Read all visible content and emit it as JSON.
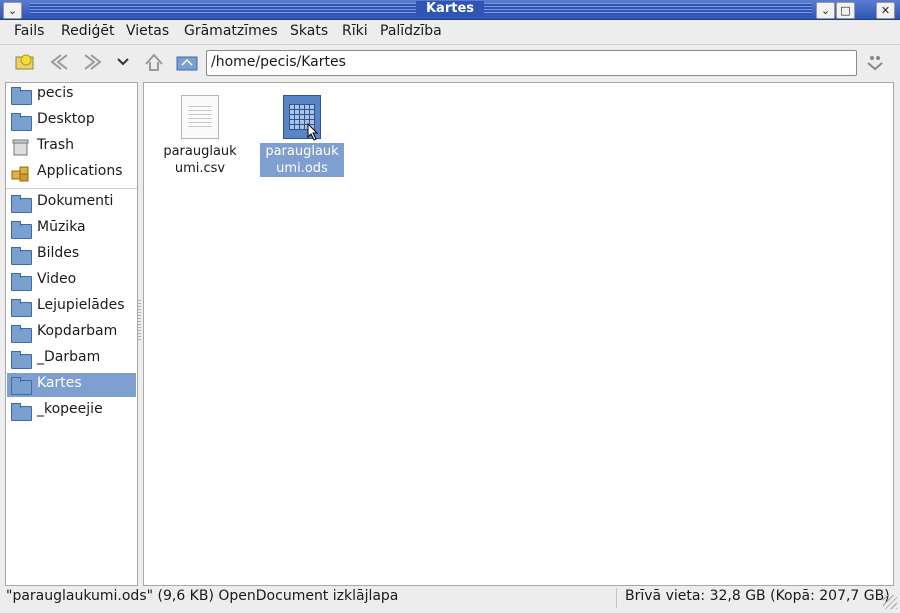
{
  "window": {
    "title": "Kartes",
    "buttons": {
      "menu": "⌄",
      "minimize": "⌄",
      "maximize": "□",
      "close": "✕"
    }
  },
  "menu": [
    "Fails",
    "Rediģēt",
    "Vietas",
    "Grāmatzīmes",
    "Skats",
    "Rīki",
    "Palīdzība"
  ],
  "toolbar": {
    "location": "/home/pecis/Kartes",
    "icons": [
      "new-folder-icon",
      "back-icon",
      "forward-icon",
      "history-dropdown-icon",
      "up-icon",
      "home-icon",
      "location-toggle-icon",
      "reload-icon"
    ]
  },
  "sidebar": {
    "places": [
      {
        "label": "pecis",
        "icon": "home-folder-icon"
      },
      {
        "label": "Desktop",
        "icon": "desktop-folder-icon"
      },
      {
        "label": "Trash",
        "icon": "trash-icon"
      },
      {
        "label": "Applications",
        "icon": "applications-icon"
      }
    ],
    "bookmarks": [
      {
        "label": "Dokumenti"
      },
      {
        "label": "Mūzika"
      },
      {
        "label": "Bildes"
      },
      {
        "label": "Video"
      },
      {
        "label": "Lejupielādes"
      },
      {
        "label": "Kopdarbam"
      },
      {
        "label": "_Darbam"
      },
      {
        "label": "Kartes",
        "selected": true
      },
      {
        "label": "_kopeejie"
      }
    ]
  },
  "files": [
    {
      "name": "parauglaukumi.csv",
      "icon": "text-document-icon",
      "selected": false
    },
    {
      "name": "parauglaukumi.ods",
      "icon": "spreadsheet-icon",
      "selected": true
    }
  ],
  "status": {
    "left": "\"parauglaukumi.ods\" (9,6 KB) OpenDocument izklājlapa",
    "right": "Brīvā vieta: 32,8 GB (Kopā: 207,7 GB)"
  },
  "colors": {
    "selection": "#7f9fd0",
    "titlebar": "#2f55b4"
  }
}
